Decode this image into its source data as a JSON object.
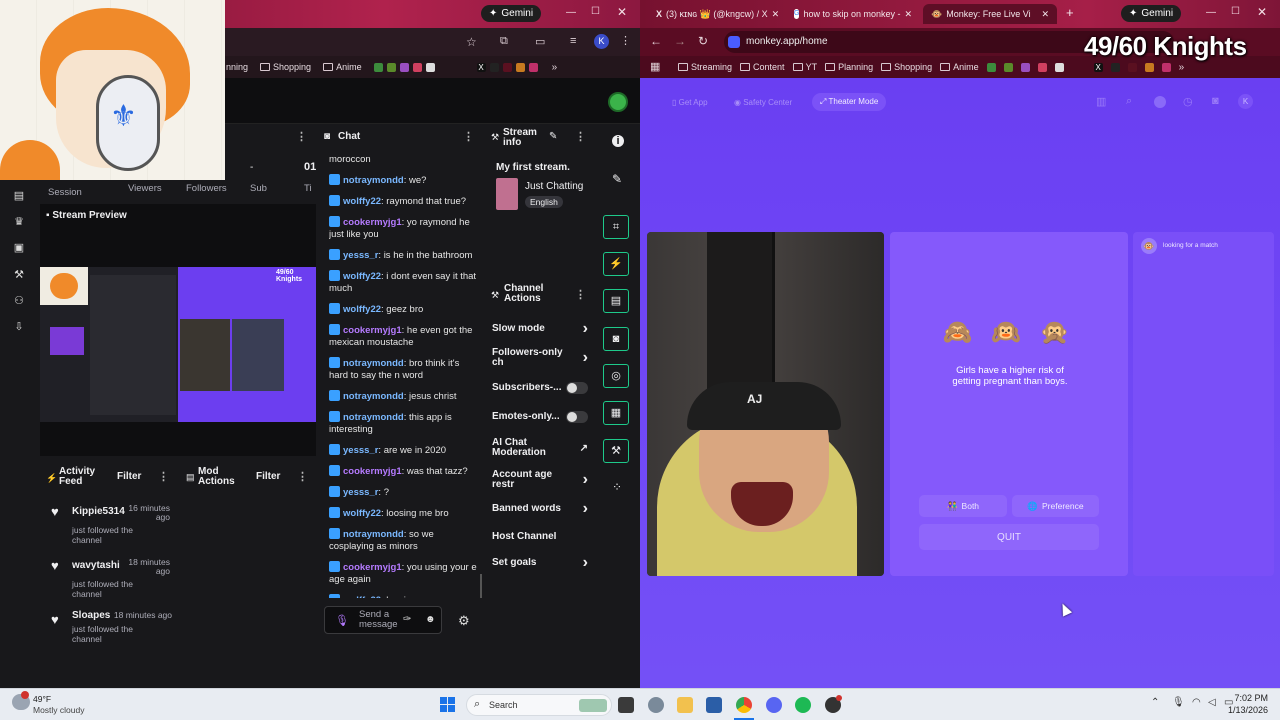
{
  "left_browser": {
    "gemini_label": "Gemini",
    "bookmarks": [
      "nning",
      "Shopping",
      "Anime"
    ],
    "profile_letter": "K"
  },
  "dashboard_header": {
    "col_session": "Session",
    "col_viewers": "Viewers",
    "col_followers": "Followers",
    "col_sub": "Sub",
    "col_ti": "Ti",
    "value_dash": "-",
    "value_01": "01"
  },
  "stream_preview": {
    "title": "Stream Preview",
    "overlay_text": "49/60 Knights"
  },
  "chat": {
    "title": "Chat",
    "messages": [
      {
        "user": "",
        "text": "moroccon",
        "color": "blue"
      },
      {
        "user": "notraymondd",
        "text": "we?",
        "color": "blue"
      },
      {
        "user": "wolffy22",
        "text": "raymond that true?",
        "color": "blue"
      },
      {
        "user": "cookermyjg1",
        "text": "yo raymond he just like you",
        "color": "purple"
      },
      {
        "user": "yesss_r",
        "text": "is he in the bathroom",
        "color": "blue"
      },
      {
        "user": "wolffy22",
        "text": "i dont even say it that much",
        "color": "blue"
      },
      {
        "user": "wolffy22",
        "text": "geez bro",
        "color": "blue"
      },
      {
        "user": "cookermyjg1",
        "text": "he even got the mexican moustache",
        "color": "purple"
      },
      {
        "user": "notraymondd",
        "text": "bro think it's hard to say the n word",
        "color": "blue"
      },
      {
        "user": "notraymondd",
        "text": "jesus christ",
        "color": "blue"
      },
      {
        "user": "notraymondd",
        "text": "this app is interesting",
        "color": "blue"
      },
      {
        "user": "yesss_r",
        "text": "are we in 2020",
        "color": "blue"
      },
      {
        "user": "cookermyjg1",
        "text": "was that tazz?",
        "color": "purple"
      },
      {
        "user": "yesss_r",
        "text": "?",
        "color": "blue"
      },
      {
        "user": "wolffy22",
        "text": "loosing me bro",
        "color": "blue"
      },
      {
        "user": "notraymondd",
        "text": "so we cosplaying as minors",
        "color": "blue"
      },
      {
        "user": "cookermyjg1",
        "text": "you using your e age again",
        "color": "purple"
      },
      {
        "user": "wolffy22",
        "text": "loosing me",
        "color": "blue"
      }
    ],
    "input_placeholder": "Send a message"
  },
  "stream_info": {
    "title": "Stream info",
    "stream_title": "My first stream.",
    "category": "Just Chatting",
    "language": "English"
  },
  "channel_actions": {
    "title": "Channel Actions",
    "items": [
      {
        "label": "Slow mode",
        "control": "chevron"
      },
      {
        "label": "Followers-only ch",
        "control": "chevron"
      },
      {
        "label": "Subscribers-...",
        "control": "toggle"
      },
      {
        "label": "Emotes-only...",
        "control": "toggle"
      },
      {
        "label": "AI Chat Moderation",
        "control": "external"
      },
      {
        "label": "Account age restr",
        "control": "chevron"
      },
      {
        "label": "Banned words",
        "control": "chevron"
      },
      {
        "label": "Host Channel",
        "control": "none"
      },
      {
        "label": "Set goals",
        "control": "chevron"
      }
    ]
  },
  "activity_feed": {
    "title": "Activity Feed",
    "filter_label": "Filter",
    "items": [
      {
        "name": "Kippie5314",
        "time": "16 minutes ago",
        "action": "just followed the channel"
      },
      {
        "name": "wavytashi",
        "time": "18 minutes ago",
        "action": "just followed the channel"
      },
      {
        "name": "Sloapes",
        "time": "18 minutes ago",
        "action": "just followed the channel"
      }
    ]
  },
  "mod_actions": {
    "title": "Mod Actions",
    "filter_label": "Filter"
  },
  "right_browser": {
    "tabs": [
      {
        "label": "(3) ᴋɪɴɢ 👑 (@kngcw) / X",
        "icon": "x-icon"
      },
      {
        "label": "how to skip on monkey - ",
        "icon": "google-icon"
      },
      {
        "label": "Monkey: Free Live Vi",
        "icon": "monkey-icon"
      }
    ],
    "gemini_label": "Gemini",
    "url": "monkey.app/home",
    "bookmarks": [
      "Streaming",
      "Content",
      "YT",
      "Planning",
      "Shopping",
      "Anime"
    ]
  },
  "monkey": {
    "nav": [
      "Get App",
      "Safety Center",
      "Theater Mode"
    ],
    "emojis": "🙈 🙉 🙊",
    "fact": "Girls have a higher risk of getting pregnant than boys.",
    "both_label": "Both",
    "preference_label": "Preference",
    "quit_label": "QUIT",
    "status": "looking for a match",
    "profile_letter": "K"
  },
  "counter": "49/60 Knights",
  "taskbar": {
    "temperature": "49°F",
    "weather": "Mostly cloudy",
    "search_label": "Search",
    "time": "7:02 PM",
    "date": "1/13/2026"
  }
}
